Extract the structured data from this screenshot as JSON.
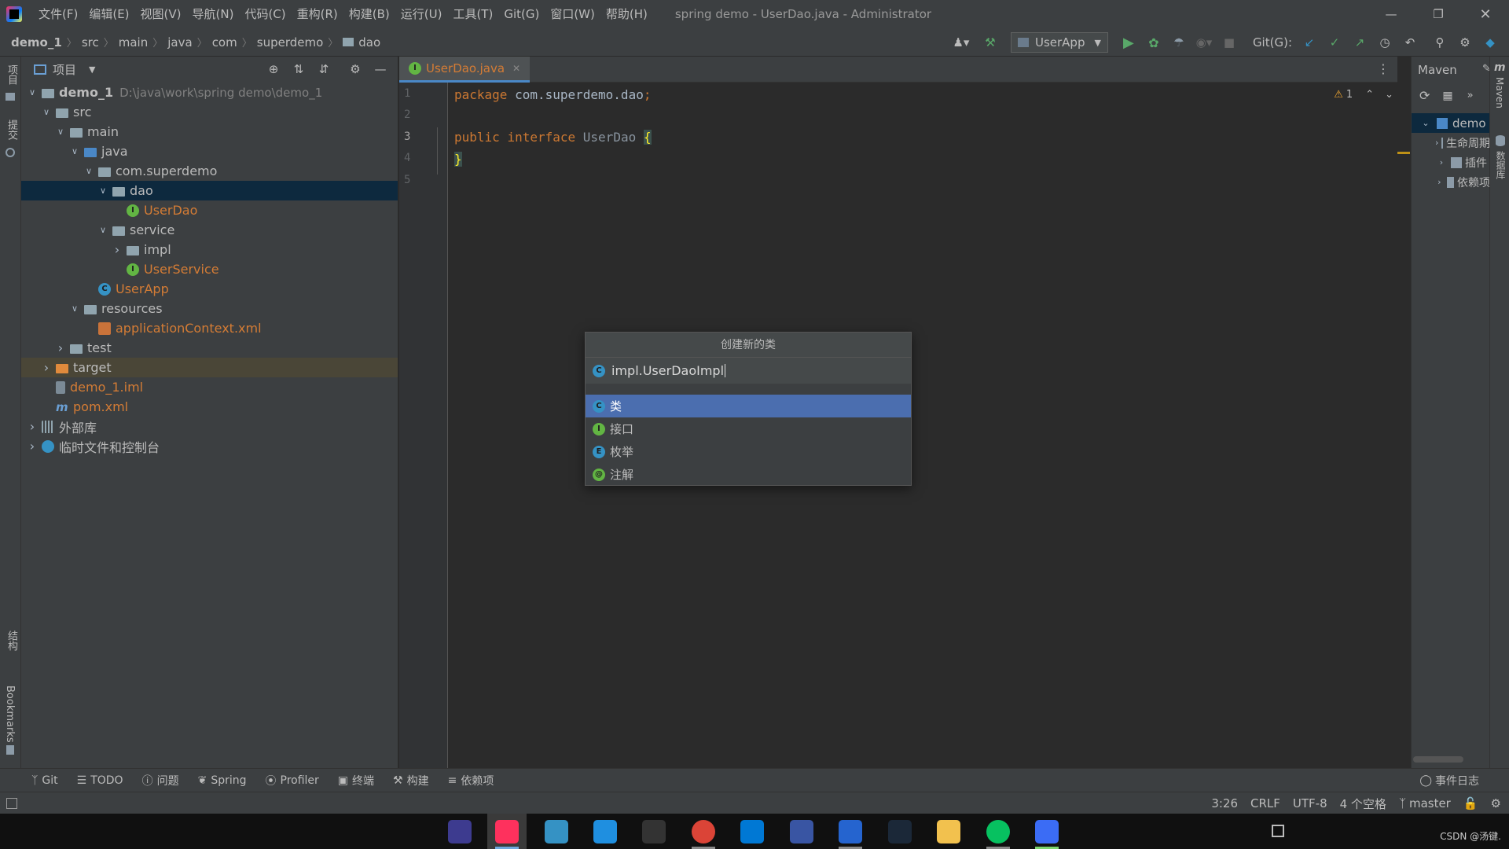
{
  "window": {
    "title": "spring demo - UserDao.java - Administrator",
    "menu": [
      "文件(F)",
      "编辑(E)",
      "视图(V)",
      "导航(N)",
      "代码(C)",
      "重构(R)",
      "构建(B)",
      "运行(U)",
      "工具(T)",
      "Git(G)",
      "窗口(W)",
      "帮助(H)"
    ]
  },
  "breadcrumb": [
    "demo_1",
    "src",
    "main",
    "java",
    "com",
    "superdemo",
    "dao"
  ],
  "toolbar": {
    "run_config": "UserApp",
    "git_label": "Git(G):"
  },
  "left_strip": {
    "project": "项目",
    "commit": "提交",
    "structure": "结构",
    "bookmarks": "Bookmarks"
  },
  "project_panel": {
    "title": "项目",
    "tree": [
      {
        "label": "demo_1",
        "path": "D:\\java\\work\\spring demo\\demo_1"
      },
      {
        "label": "src"
      },
      {
        "label": "main"
      },
      {
        "label": "java"
      },
      {
        "label": "com.superdemo"
      },
      {
        "label": "dao"
      },
      {
        "label": "UserDao"
      },
      {
        "label": "service"
      },
      {
        "label": "impl"
      },
      {
        "label": "UserService"
      },
      {
        "label": "UserApp"
      },
      {
        "label": "resources"
      },
      {
        "label": "applicationContext.xml"
      },
      {
        "label": "test"
      },
      {
        "label": "target"
      },
      {
        "label": "demo_1.iml"
      },
      {
        "label": "pom.xml"
      },
      {
        "label": "外部库"
      },
      {
        "label": "临时文件和控制台"
      }
    ]
  },
  "editor": {
    "tab": "UserDao.java",
    "lines": [
      "1",
      "2",
      "3",
      "4",
      "5"
    ],
    "code": {
      "line1_kw": "package",
      "line1_rest": " com.superdemo.dao",
      "line1_semi": ";",
      "line3_kw1": "public",
      "line3_kw2": "interface",
      "line3_name": "UserDao",
      "open_brace": "{",
      "close_brace": "}"
    },
    "warnings": "1"
  },
  "maven": {
    "title": "Maven",
    "root": "demo",
    "items": [
      "生命周期",
      "插件",
      "依赖项"
    ],
    "strip_label": "Maven",
    "strip_label2": "数据库"
  },
  "dialog": {
    "title": "创建新的类",
    "input_value": "impl.UserDaoImpl",
    "options": [
      "类",
      "接口",
      "枚举",
      "注解"
    ],
    "selected": 0
  },
  "tool_windows": [
    "Git",
    "TODO",
    "问题",
    "Spring",
    "Profiler",
    "终端",
    "构建",
    "依赖项"
  ],
  "event_log": "事件日志",
  "status": {
    "position": "3:26",
    "line_sep": "CRLF",
    "encoding": "UTF-8",
    "indent": "4 个空格",
    "branch": "master"
  },
  "taskbar": {
    "watermark": "CSDN @汤键."
  },
  "colors": {
    "accent": "#4a88c7",
    "selection": "#4b6eaf",
    "keyword": "#cc7832",
    "orange": "#d47c35"
  }
}
